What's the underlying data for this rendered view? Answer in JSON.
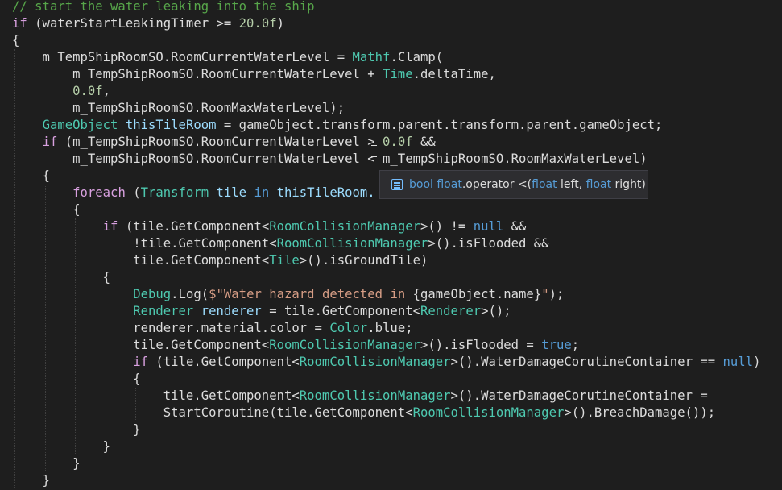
{
  "editor": {
    "lines": [
      [
        {
          "t": "// start the water leaking into the ship",
          "c": "com"
        }
      ],
      [
        {
          "t": "if",
          "c": "ctl"
        },
        {
          "t": " (waterStartLeakingTimer >= ",
          "c": "punc"
        },
        {
          "t": "20.0f",
          "c": "num"
        },
        {
          "t": ")",
          "c": "punc"
        }
      ],
      [
        {
          "t": "{",
          "c": "punc"
        }
      ],
      [
        {
          "t": "    m_TempShipRoomSO.RoomCurrentWaterLevel = ",
          "c": "punc"
        },
        {
          "t": "Mathf",
          "c": "type"
        },
        {
          "t": ".Clamp(",
          "c": "punc"
        }
      ],
      [
        {
          "t": "        m_TempShipRoomSO.RoomCurrentWaterLevel + ",
          "c": "punc"
        },
        {
          "t": "Time",
          "c": "type"
        },
        {
          "t": ".deltaTime,",
          "c": "punc"
        }
      ],
      [
        {
          "t": "        ",
          "c": "punc"
        },
        {
          "t": "0.0f",
          "c": "num"
        },
        {
          "t": ",",
          "c": "punc"
        }
      ],
      [
        {
          "t": "        m_TempShipRoomSO.RoomMaxWaterLevel);",
          "c": "punc"
        }
      ],
      [
        {
          "t": "    ",
          "c": "punc"
        },
        {
          "t": "GameObject",
          "c": "type"
        },
        {
          "t": " thisTileRoom",
          "c": "var"
        },
        {
          "t": " = gameObject.transform.parent.transform.parent.gameObject;",
          "c": "punc"
        }
      ],
      [
        {
          "t": "    ",
          "c": "punc"
        },
        {
          "t": "if",
          "c": "ctl"
        },
        {
          "t": " (m_TempShipRoomSO.RoomCurrentWaterLevel > ",
          "c": "punc"
        },
        {
          "t": "0.0f",
          "c": "num"
        },
        {
          "t": " &&",
          "c": "punc"
        }
      ],
      [
        {
          "t": "        m_TempShipRoomSO.RoomCurrentWaterLevel < m_TempShipRoomSO.RoomMaxWaterLevel)",
          "c": "punc"
        }
      ],
      [
        {
          "t": "    {",
          "c": "punc"
        }
      ],
      [
        {
          "t": "        ",
          "c": "punc"
        },
        {
          "t": "foreach",
          "c": "ctl"
        },
        {
          "t": " (",
          "c": "punc"
        },
        {
          "t": "Transform",
          "c": "type"
        },
        {
          "t": " tile",
          "c": "var"
        },
        {
          "t": " in",
          "c": "kw"
        },
        {
          "t": " thisTileRoom.",
          "c": "var"
        }
      ],
      [
        {
          "t": "        {",
          "c": "punc"
        }
      ],
      [
        {
          "t": "            ",
          "c": "punc"
        },
        {
          "t": "if",
          "c": "ctl"
        },
        {
          "t": " (tile.GetComponent<",
          "c": "punc"
        },
        {
          "t": "RoomCollisionManager",
          "c": "type"
        },
        {
          "t": ">() != ",
          "c": "punc"
        },
        {
          "t": "null",
          "c": "kw"
        },
        {
          "t": " &&",
          "c": "punc"
        }
      ],
      [
        {
          "t": "                !tile.GetComponent<",
          "c": "punc"
        },
        {
          "t": "RoomCollisionManager",
          "c": "type"
        },
        {
          "t": ">().isFlooded &&",
          "c": "punc"
        }
      ],
      [
        {
          "t": "                tile.GetComponent<",
          "c": "punc"
        },
        {
          "t": "Tile",
          "c": "type"
        },
        {
          "t": ">().isGroundTile)",
          "c": "punc"
        }
      ],
      [
        {
          "t": "            {",
          "c": "punc"
        }
      ],
      [
        {
          "t": "                ",
          "c": "punc"
        },
        {
          "t": "Debug",
          "c": "type"
        },
        {
          "t": ".Log(",
          "c": "punc"
        },
        {
          "t": "$\"Water hazard detected in ",
          "c": "str"
        },
        {
          "t": "{gameObject.name}",
          "c": "punc"
        },
        {
          "t": "\"",
          "c": "str"
        },
        {
          "t": ");",
          "c": "punc"
        }
      ],
      [
        {
          "t": "                ",
          "c": "punc"
        },
        {
          "t": "Renderer",
          "c": "type"
        },
        {
          "t": " renderer",
          "c": "var"
        },
        {
          "t": " = tile.GetComponent<",
          "c": "punc"
        },
        {
          "t": "Renderer",
          "c": "type"
        },
        {
          "t": ">();",
          "c": "punc"
        }
      ],
      [
        {
          "t": "                renderer.material.color = ",
          "c": "punc"
        },
        {
          "t": "Color",
          "c": "type"
        },
        {
          "t": ".blue;",
          "c": "punc"
        }
      ],
      [
        {
          "t": "                tile.GetComponent<",
          "c": "punc"
        },
        {
          "t": "RoomCollisionManager",
          "c": "type"
        },
        {
          "t": ">().isFlooded = ",
          "c": "punc"
        },
        {
          "t": "true",
          "c": "kw"
        },
        {
          "t": ";",
          "c": "punc"
        }
      ],
      [
        {
          "t": "                ",
          "c": "punc"
        },
        {
          "t": "if",
          "c": "ctl"
        },
        {
          "t": " (tile.GetComponent<",
          "c": "punc"
        },
        {
          "t": "RoomCollisionManager",
          "c": "type"
        },
        {
          "t": ">().WaterDamageCorutineContainer == ",
          "c": "punc"
        },
        {
          "t": "null",
          "c": "kw"
        },
        {
          "t": ")",
          "c": "punc"
        }
      ],
      [
        {
          "t": "                {",
          "c": "punc"
        }
      ],
      [
        {
          "t": "                    tile.GetComponent<",
          "c": "punc"
        },
        {
          "t": "RoomCollisionManager",
          "c": "type"
        },
        {
          "t": ">().WaterDamageCorutineContainer =",
          "c": "punc"
        }
      ],
      [
        {
          "t": "                    StartCoroutine(tile.GetComponent<",
          "c": "punc"
        },
        {
          "t": "RoomCollisionManager",
          "c": "type"
        },
        {
          "t": ">().BreachDamage());",
          "c": "punc"
        }
      ],
      [
        {
          "t": "                }",
          "c": "punc"
        }
      ],
      [
        {
          "t": "            }",
          "c": "punc"
        }
      ],
      [
        {
          "t": "        }",
          "c": "punc"
        }
      ],
      [
        {
          "t": "    }",
          "c": "punc"
        }
      ]
    ]
  },
  "tooltip": {
    "icon": "operator-icon",
    "parts": [
      {
        "t": "bool ",
        "c": "kw"
      },
      {
        "t": "float",
        "c": "kw"
      },
      {
        "t": ".operator ",
        "c": "name"
      },
      {
        "t": "<(",
        "c": "name"
      },
      {
        "t": "float ",
        "c": "kw"
      },
      {
        "t": "left, ",
        "c": "name"
      },
      {
        "t": "float ",
        "c": "kw"
      },
      {
        "t": "right)",
        "c": "name"
      }
    ]
  }
}
